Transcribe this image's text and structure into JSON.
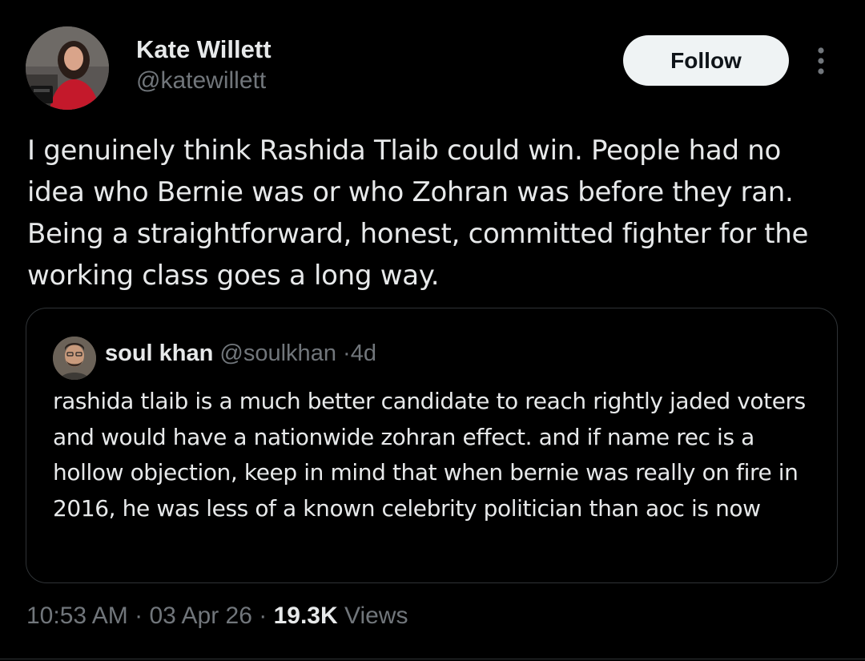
{
  "author": {
    "name": "Kate Willett",
    "handle": "@katewillett",
    "avatar_icon": "user-avatar-photo"
  },
  "follow_label": "Follow",
  "more_icon": "more-vertical-icon",
  "tweet_text": "I genuinely think Rashida Tlaib could win. People had no idea who Bernie was or who Zohran was before they ran. Being a straightforward, honest, committed fighter for the working class goes a long way.",
  "quote": {
    "name": "soul khan",
    "handle": "@soulkhan",
    "separator": "·",
    "time": "4d",
    "text": "rashida tlaib is a much better candidate to reach rightly jaded voters and would have a nationwide zohran effect. and if name rec is a hollow objection, keep in mind that when bernie was really on fire in 2016, he was less of a known celebrity politician than aoc is now"
  },
  "meta": {
    "time": "10:53 AM",
    "separator": "·",
    "date": "03 Apr 26",
    "views_count": "19.3K",
    "views_label": "Views"
  },
  "colors": {
    "background": "#000000",
    "primary_text": "#e7e9ea",
    "secondary_text": "#71767b",
    "border": "#2f3336",
    "follow_button_bg": "#eff3f4"
  }
}
